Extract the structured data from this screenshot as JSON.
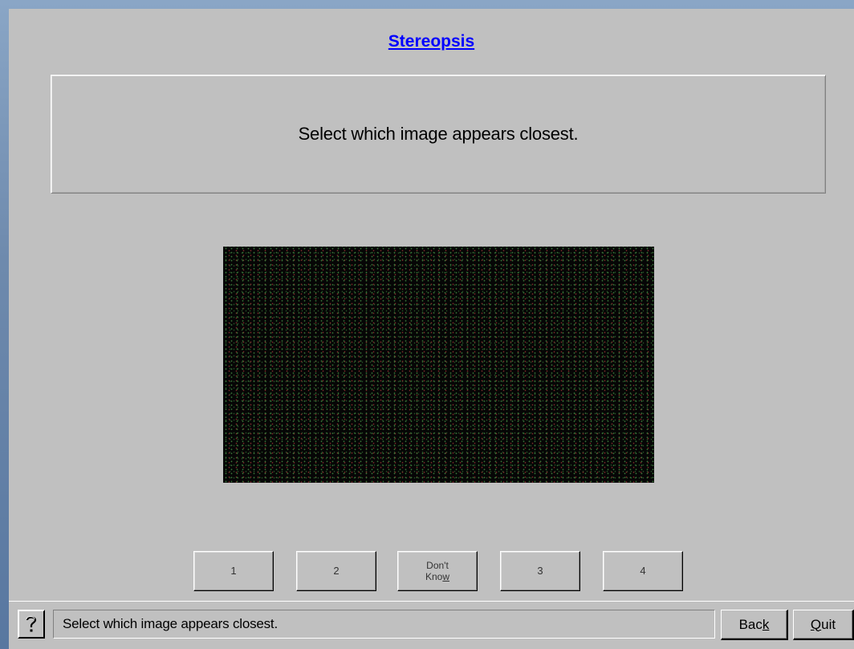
{
  "title": "Stereopsis",
  "instruction": "Select which image appears closest.",
  "answers": [
    {
      "pre": "1",
      "key": "",
      "post": ""
    },
    {
      "pre": "2",
      "key": "",
      "post": ""
    },
    {
      "pre": "Don't\nKno",
      "key": "w",
      "post": ""
    },
    {
      "pre": "3",
      "key": "",
      "post": ""
    },
    {
      "pre": "4",
      "key": "",
      "post": ""
    }
  ],
  "status": {
    "help_icon": "question-mark-icon",
    "message": "Select which image appears closest.",
    "back_pre": "Bac",
    "back_key": "k",
    "quit_key": "Q",
    "quit_post": "uit"
  }
}
